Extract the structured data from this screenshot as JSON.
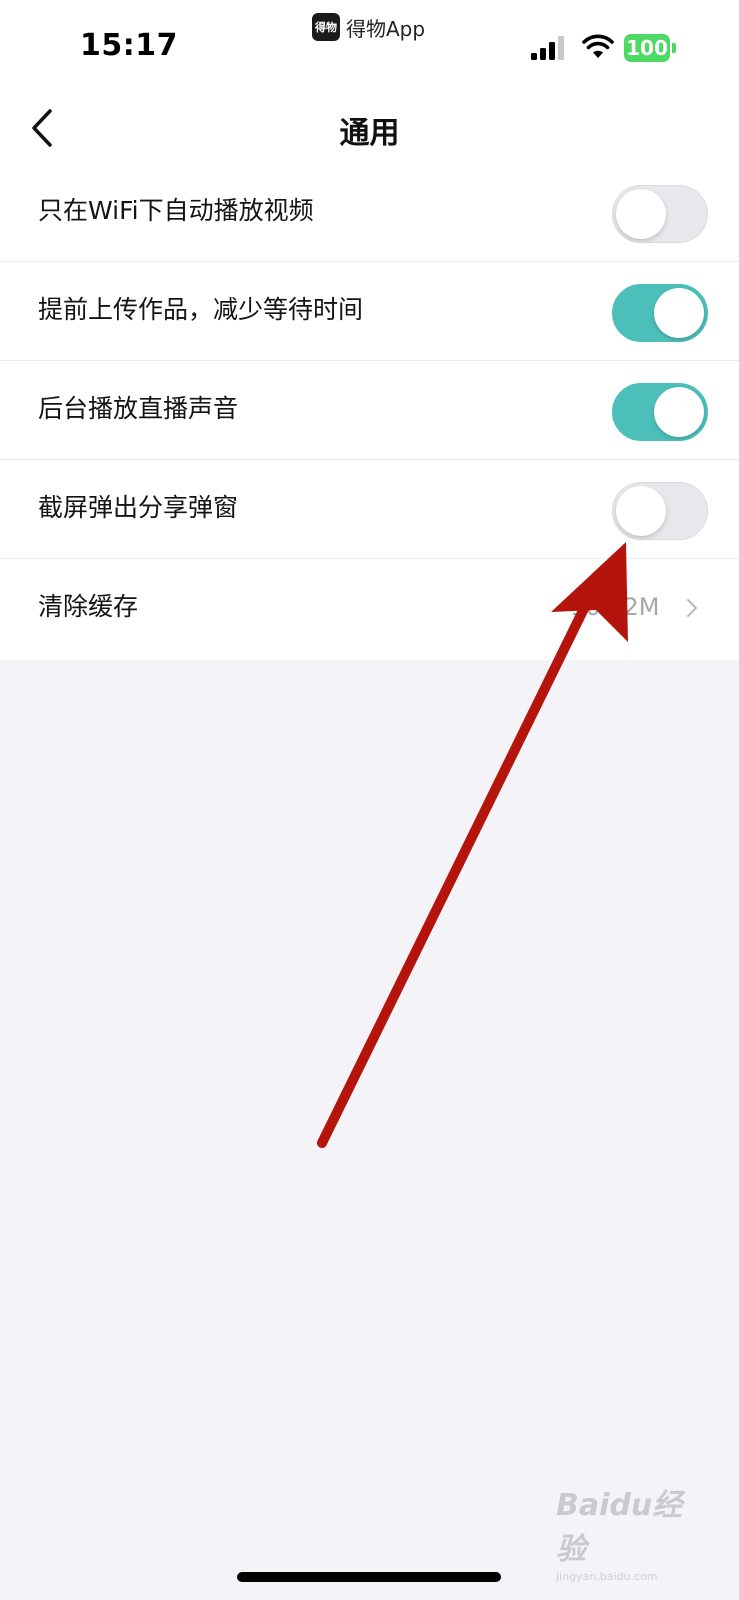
{
  "status_bar": {
    "time": "15:17",
    "app_name": "得物App",
    "app_logo_text": "得物",
    "battery": "100"
  },
  "nav": {
    "title": "通用"
  },
  "settings": {
    "items": [
      {
        "label": "只在WiFi下自动播放视频",
        "type": "toggle",
        "enabled": false
      },
      {
        "label": "提前上传作品，减少等待时间",
        "type": "toggle",
        "enabled": true
      },
      {
        "label": "后台播放直播声音",
        "type": "toggle",
        "enabled": true
      },
      {
        "label": "截屏弹出分享弹窗",
        "type": "toggle",
        "enabled": false
      },
      {
        "label": "清除缓存",
        "type": "link",
        "value": "10.12M"
      }
    ]
  },
  "watermark": {
    "brand": "Baidu经验",
    "site": "jingyan.baidu.com"
  },
  "colors": {
    "toggle_on": "#4dbfbb",
    "toggle_off": "#e8e8ec",
    "annotation_arrow": "#b5140c",
    "battery": "#4cd964"
  }
}
